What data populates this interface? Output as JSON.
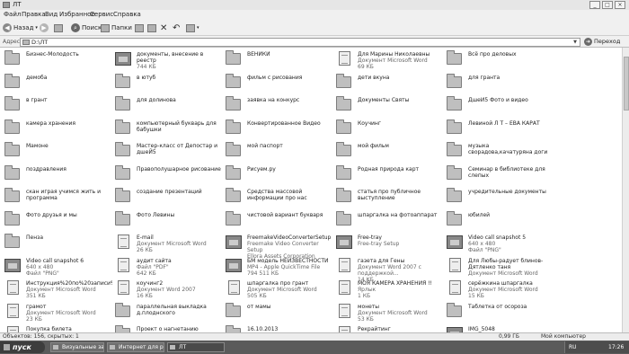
{
  "window": {
    "title": "ЛТ"
  },
  "menu": [
    "Файл",
    "Правка",
    "Вид",
    "Избранное",
    "Сервис",
    "Справка"
  ],
  "toolbar": {
    "back": "Назад",
    "search": "Поиск",
    "folders": "Папки"
  },
  "address": {
    "label": "Адрес",
    "path": "D:\\ЛТ",
    "go": "Переход"
  },
  "items": [
    {
      "name": "Бизнес-Молодость",
      "icon": "folder"
    },
    {
      "name": "документы, внесение в реестр",
      "sub": "744 КБ",
      "icon": "image"
    },
    {
      "name": "ВЕНИКИ",
      "icon": "folder"
    },
    {
      "name": "Для Марины Николаевны",
      "sub": "Документ Microsoft Word\n69 КБ",
      "icon": "doc"
    },
    {
      "name": "Всё про деловых",
      "icon": "folder"
    },
    {
      "name": "демоба",
      "icon": "folder"
    },
    {
      "name": "в ютуб",
      "icon": "folder"
    },
    {
      "name": "фильм с рисования",
      "icon": "folder"
    },
    {
      "name": "дети вкуна",
      "icon": "folder"
    },
    {
      "name": "для гранта",
      "icon": "folder"
    },
    {
      "name": "в грант",
      "icon": "folder"
    },
    {
      "name": "для долинова",
      "icon": "folder"
    },
    {
      "name": "заявка на конкурс",
      "icon": "folder"
    },
    {
      "name": "Документы Святы",
      "icon": "folder"
    },
    {
      "name": "ДшеЙ5 Фото и видео",
      "icon": "folder"
    },
    {
      "name": "камера хранения",
      "icon": "folder"
    },
    {
      "name": "компьютерный букварь для бабушки",
      "icon": "folder"
    },
    {
      "name": "Конвертированное Видео",
      "icon": "folder"
    },
    {
      "name": "Коучинг",
      "icon": "folder"
    },
    {
      "name": "Левиной Л Т – ЕВА КАРАТ",
      "icon": "folder"
    },
    {
      "name": "Мамоне",
      "icon": "folder"
    },
    {
      "name": "Мастер-класс от Депостар и дшеЙ5",
      "icon": "folder"
    },
    {
      "name": "мой паспорт",
      "icon": "folder"
    },
    {
      "name": "мой фильм",
      "icon": "folder"
    },
    {
      "name": "музыка сворадова,качатурянa доги",
      "icon": "folder"
    },
    {
      "name": "поздравления",
      "icon": "folder"
    },
    {
      "name": "Правополушарное рисование",
      "icon": "folder"
    },
    {
      "name": "Рисуем.ру",
      "icon": "folder"
    },
    {
      "name": "Родная природа карт",
      "icon": "folder"
    },
    {
      "name": "Семинар в библиотеке для слепых",
      "icon": "folder"
    },
    {
      "name": "скан играя учимся жить и программа",
      "icon": "folder"
    },
    {
      "name": "создание презентаций",
      "icon": "folder"
    },
    {
      "name": "Средства массовой информации про нас",
      "icon": "folder"
    },
    {
      "name": "статья про публичное выступление",
      "icon": "folder"
    },
    {
      "name": "учредительные документы",
      "icon": "folder"
    },
    {
      "name": "Фото друзья и мы",
      "icon": "folder"
    },
    {
      "name": "Фото Левины",
      "icon": "folder"
    },
    {
      "name": "чистовой вариант букваря",
      "icon": "folder"
    },
    {
      "name": "шпаргалка на фотоаппарат",
      "icon": "folder"
    },
    {
      "name": "юбилей",
      "icon": "folder"
    },
    {
      "name": "Пенза",
      "icon": "folder"
    },
    {
      "name": "E-mail",
      "sub": "Документ Microsoft Word\n26 КБ",
      "icon": "doc"
    },
    {
      "name": "FreemakeVideoConverterSetup",
      "sub": "Freemake Video Converter Setup\nEllora Assets Corporation",
      "icon": "app"
    },
    {
      "name": "Free-tray",
      "sub": "Free-tray Setup",
      "icon": "app"
    },
    {
      "name": "Video call snapshot 5",
      "sub": "640 x 480\nФайл \"PNG\"",
      "icon": "image"
    },
    {
      "name": "Video call snapshot 6",
      "sub": "640 x 480\nФайл \"PNG\"",
      "icon": "image"
    },
    {
      "name": "аудит сайта",
      "sub": "Файл \"PDF\"\n642 КБ",
      "icon": "doc"
    },
    {
      "name": "БМ модель НЕИЗВЕСТНОСТИ",
      "sub": "MP4 - Apple QuickTime File\n794 511 КБ",
      "icon": "mov"
    },
    {
      "name": "газета для Гены",
      "sub": "Документ Word 2007 с поддержкой...\n14 КБ",
      "icon": "doc"
    },
    {
      "name": "Для Любы-радует блинов-Дятленко таня",
      "sub": "Документ Microsoft Word",
      "icon": "doc"
    },
    {
      "name": "Инструкция%20по%20записи%20и...",
      "sub": "Документ Microsoft Word\n351 КБ",
      "icon": "doc"
    },
    {
      "name": "коучинг2",
      "sub": "Документ Word 2007\n16 КБ",
      "icon": "doc"
    },
    {
      "name": "шпаргалка про грант",
      "sub": "Документ Microsoft Word\n505 КБ",
      "icon": "doc"
    },
    {
      "name": "МОЯ КАМЕРА ХРАНЕНИЯ !!",
      "sub": "Ярлык\n1 КБ",
      "icon": "doc"
    },
    {
      "name": "серёжкина шпаргалка",
      "sub": "Документ Microsoft Word\n15 КБ",
      "icon": "doc"
    },
    {
      "name": "грамот",
      "sub": "Документ Microsoft Word\n23 КБ",
      "icon": "doc"
    },
    {
      "name": "параллельная выкладка д.плоднского",
      "icon": "folder"
    },
    {
      "name": "от мамы",
      "icon": "folder"
    },
    {
      "name": "монеты",
      "sub": "Документ Microsoft Word\n53 КБ",
      "icon": "doc"
    },
    {
      "name": "Таблетка от осороза",
      "icon": "folder"
    },
    {
      "name": "Покупка билета",
      "icon": "doc"
    },
    {
      "name": "Проект о нагнетанию детского",
      "icon": "folder"
    },
    {
      "name": "16.10.2013",
      "icon": "folder"
    },
    {
      "name": "Рекрайтинг",
      "icon": "doc"
    },
    {
      "name": "IMG_5048",
      "icon": "image"
    }
  ],
  "status": {
    "objects": "Объектов: 156, скрытых: 1",
    "size": "0,99 ГБ",
    "location": "Мой компьютер"
  },
  "taskbar": {
    "start": "пуск",
    "tasks": [
      "Визуальные закл...",
      "Интернет для ре...",
      "ЛТ"
    ],
    "lang": "RU",
    "clock": "17:26"
  }
}
